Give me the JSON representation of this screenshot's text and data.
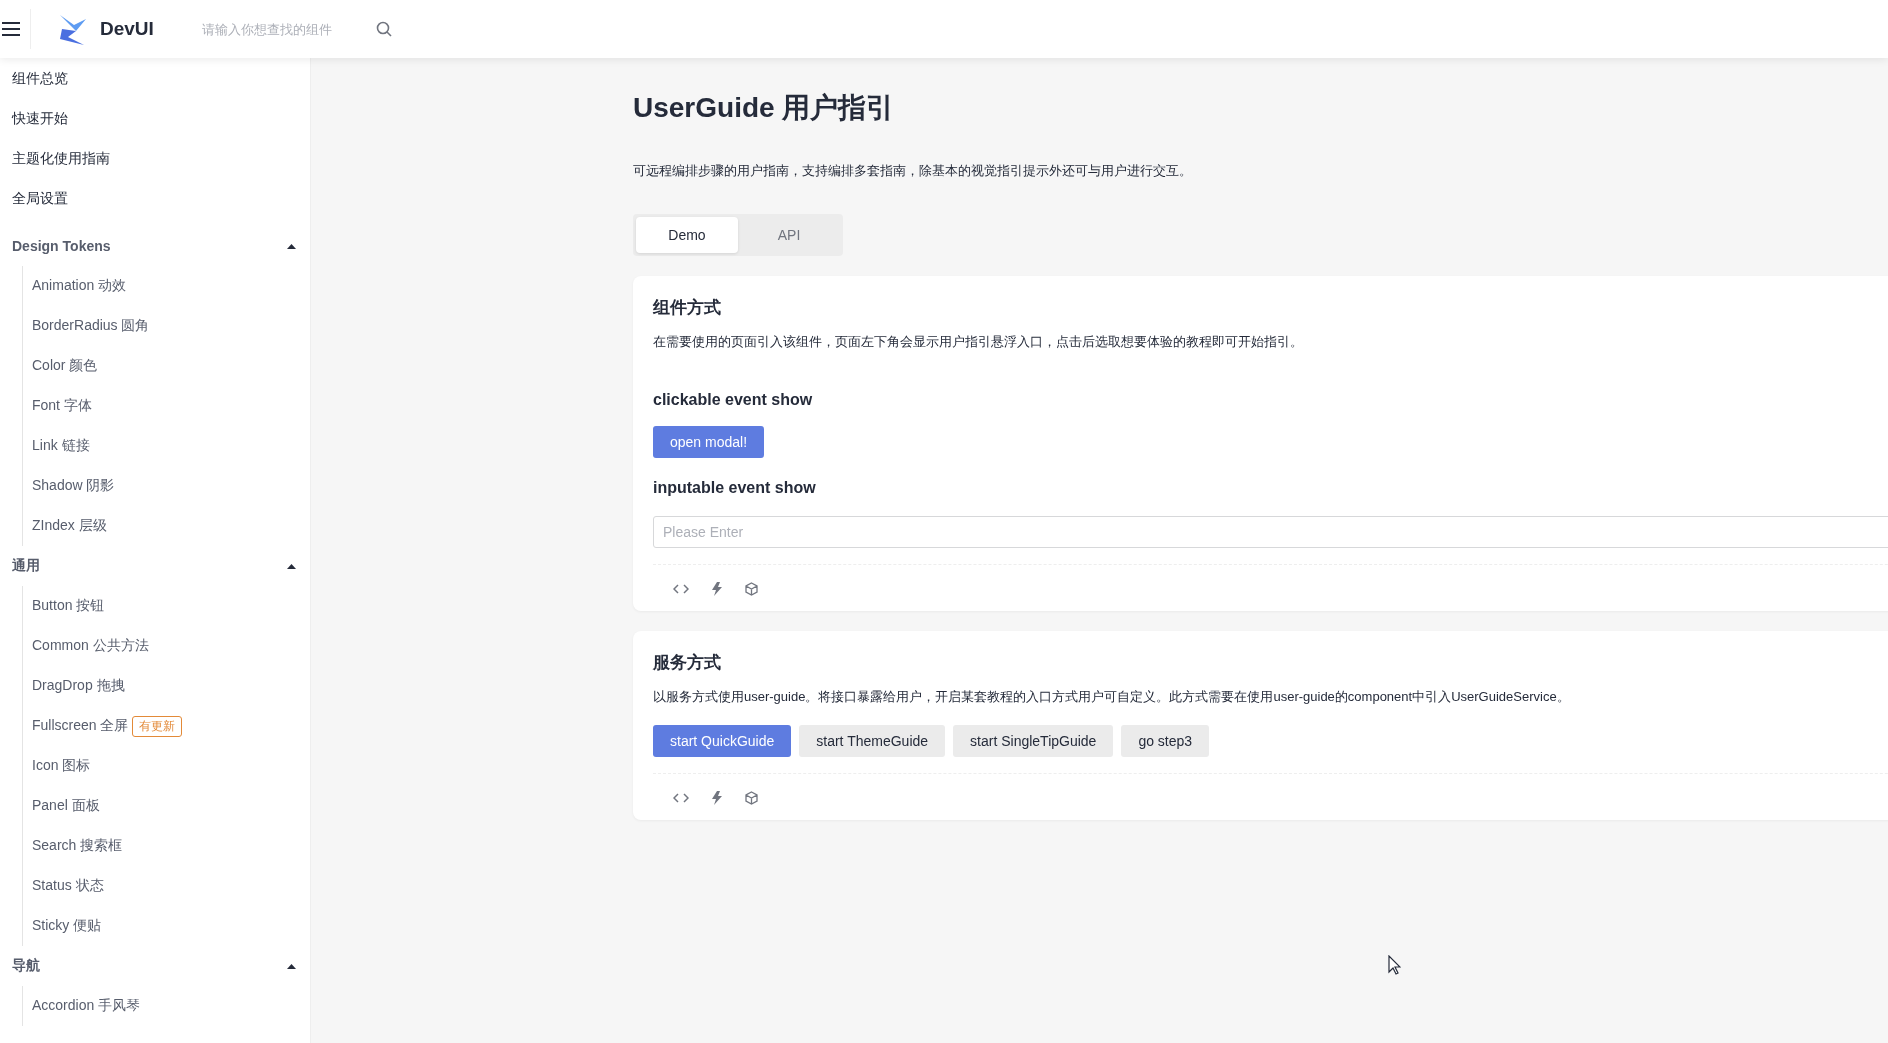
{
  "header": {
    "logo_text": "DevUI",
    "search_placeholder": "请输入你想查找的组件"
  },
  "sidebar": {
    "items": [
      {
        "label": "组件总览"
      },
      {
        "label": "快速开始"
      },
      {
        "label": "主题化使用指南"
      },
      {
        "label": "全局设置"
      }
    ],
    "groups": [
      {
        "title": "Design Tokens",
        "expanded": true,
        "items": [
          {
            "label": "Animation 动效"
          },
          {
            "label": "BorderRadius 圆角"
          },
          {
            "label": "Color 颜色"
          },
          {
            "label": "Font 字体"
          },
          {
            "label": "Link 链接"
          },
          {
            "label": "Shadow 阴影"
          },
          {
            "label": "ZIndex 层级"
          }
        ]
      },
      {
        "title": "通用",
        "expanded": true,
        "items": [
          {
            "label": "Button 按钮"
          },
          {
            "label": "Common 公共方法"
          },
          {
            "label": "DragDrop 拖拽"
          },
          {
            "label": "Fullscreen 全屏",
            "badge": "有更新"
          },
          {
            "label": "Icon 图标"
          },
          {
            "label": "Panel 面板"
          },
          {
            "label": "Search 搜索框"
          },
          {
            "label": "Status 状态"
          },
          {
            "label": "Sticky 便贴"
          }
        ]
      },
      {
        "title": "导航",
        "expanded": true,
        "items": [
          {
            "label": "Accordion 手风琴"
          }
        ]
      }
    ]
  },
  "page": {
    "title": "UserGuide 用户指引",
    "description": "可远程编排步骤的用户指南，支持编排多套指南，除基本的视觉指引提示外还可与用户进行交互。",
    "tabs": [
      {
        "label": "Demo",
        "selected": true
      },
      {
        "label": "API",
        "selected": false
      }
    ],
    "cards": [
      {
        "title": "组件方式",
        "description": "在需要使用的页面引入该组件，页面左下角会显示用户指引悬浮入口，点击后选取想要体验的教程即可开始指引。",
        "blocks": [
          {
            "kind": "heading",
            "text": "clickable event show"
          },
          {
            "kind": "buttons",
            "buttons": [
              {
                "label": "open modal!",
                "kind": "primary"
              }
            ]
          },
          {
            "kind": "heading",
            "text": "inputable event show"
          },
          {
            "kind": "input",
            "placeholder": "Please Enter"
          }
        ]
      },
      {
        "title": "服务方式",
        "description": "以服务方式使用user-guide。将接口暴露给用户，开启某套教程的入口方式用户可自定义。此方式需要在使用user-guide的component中引入UserGuideService。",
        "blocks": [
          {
            "kind": "buttons",
            "buttons": [
              {
                "label": "start QuickGuide",
                "kind": "primary"
              },
              {
                "label": "start ThemeGuide",
                "kind": "default"
              },
              {
                "label": "start SingleTipGuide",
                "kind": "default"
              },
              {
                "label": "go step3",
                "kind": "default"
              }
            ]
          }
        ]
      }
    ]
  }
}
